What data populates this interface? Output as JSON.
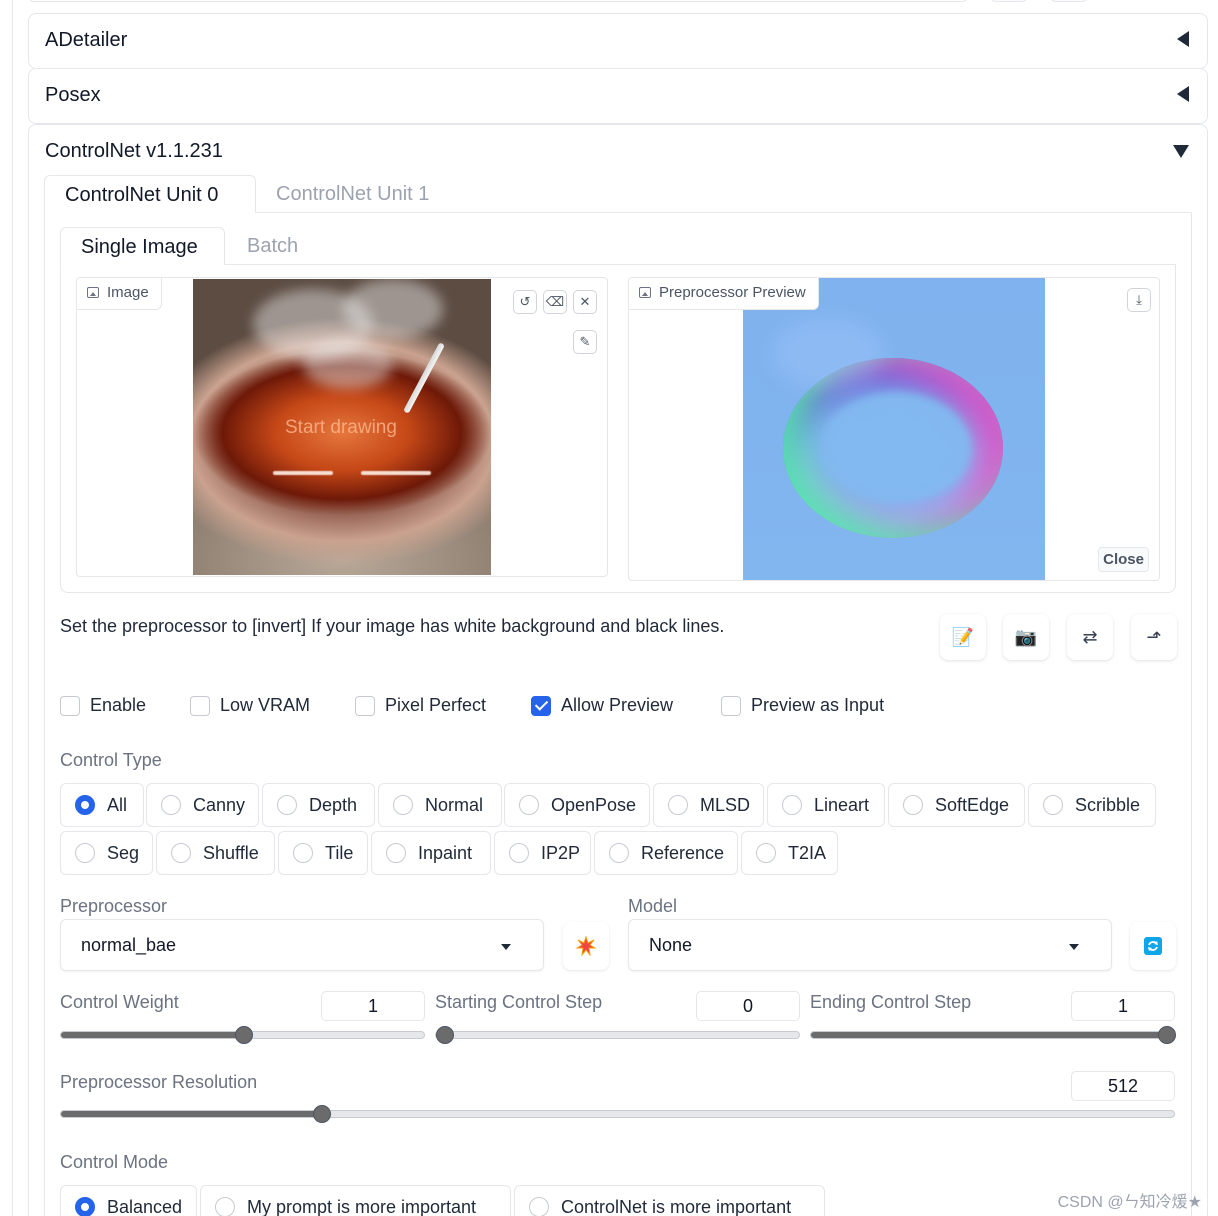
{
  "accordions": {
    "adetailer": "ADetailer",
    "posex": "Posex",
    "controlnet": "ControlNet v1.1.231"
  },
  "unit_tabs": [
    "ControlNet Unit 0",
    "ControlNet Unit 1"
  ],
  "image_tabs": [
    "Single Image",
    "Batch"
  ],
  "image_panel": {
    "label": "Image",
    "draw_hint": "Start drawing"
  },
  "preview_panel": {
    "label": "Preprocessor Preview",
    "close_label": "Close"
  },
  "hint": "Set the preprocessor to [invert] If your image has white background and black lines.",
  "checkboxes": [
    {
      "label": "Enable",
      "checked": false
    },
    {
      "label": "Low VRAM",
      "checked": false
    },
    {
      "label": "Pixel Perfect",
      "checked": false
    },
    {
      "label": "Allow Preview",
      "checked": true
    },
    {
      "label": "Preview as Input",
      "checked": false
    }
  ],
  "control_type": {
    "label": "Control Type",
    "options": [
      "All",
      "Canny",
      "Depth",
      "Normal",
      "OpenPose",
      "MLSD",
      "Lineart",
      "SoftEdge",
      "Scribble",
      "Seg",
      "Shuffle",
      "Tile",
      "Inpaint",
      "IP2P",
      "Reference",
      "T2IA"
    ],
    "selected": "All"
  },
  "preprocessor": {
    "label": "Preprocessor",
    "value": "normal_bae"
  },
  "model": {
    "label": "Model",
    "value": "None"
  },
  "sliders": {
    "control_weight": {
      "label": "Control Weight",
      "value": "1",
      "fraction": 0.5
    },
    "starting_step": {
      "label": "Starting Control Step",
      "value": "0",
      "fraction": 0.0
    },
    "ending_step": {
      "label": "Ending Control Step",
      "value": "1",
      "fraction": 1.0
    },
    "resolution": {
      "label": "Preprocessor Resolution",
      "value": "512",
      "fraction": 0.23
    }
  },
  "control_mode": {
    "label": "Control Mode",
    "options": [
      "Balanced",
      "My prompt is more important",
      "ControlNet is more important"
    ],
    "selected": "Balanced"
  },
  "watermark": "CSDN @ㄣ知冷煖★",
  "colors": {
    "accent": "#2563eb",
    "slider": "#6b6b6b",
    "border": "#e5e7eb"
  }
}
